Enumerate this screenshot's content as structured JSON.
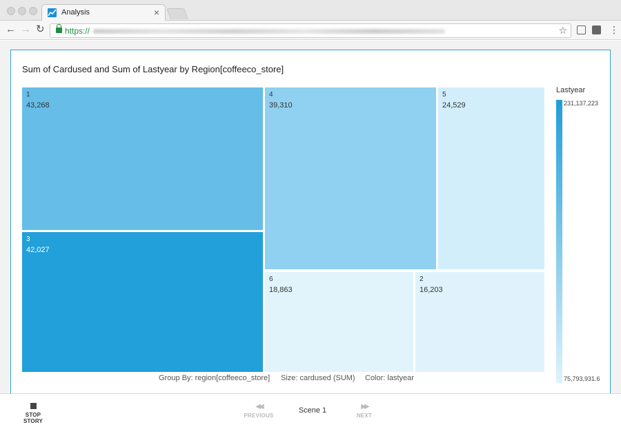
{
  "browser": {
    "tab_title": "Analysis",
    "url_scheme": "https://",
    "colors": {
      "lock": "#1e8e3e",
      "accent": "#2e9fd6"
    }
  },
  "visual": {
    "title": "Sum of Cardused and Sum of Lastyear by Region[coffeeco_store]",
    "group_by": "Group By: region[coffeeco_store]",
    "size": "Size: cardused (SUM)",
    "color": "Color: lastyear",
    "legend": {
      "title": "Lastyear",
      "max_label": "231,137,223",
      "min_label": "75,793,931.6"
    }
  },
  "chart_data": {
    "type": "treemap",
    "title": "Sum of Cardused and Sum of Lastyear by Region[coffeeco_store]",
    "size_measure": "cardused (SUM)",
    "color_measure": "lastyear",
    "group_by": "region[coffeeco_store]",
    "tiles": [
      {
        "name": "1",
        "label": "43,268",
        "value": 43268,
        "color": "#66bde8"
      },
      {
        "name": "3",
        "label": "42,027",
        "value": 42027,
        "color": "#21a0d9"
      },
      {
        "name": "4",
        "label": "39,310",
        "value": 39310,
        "color": "#90d1f1"
      },
      {
        "name": "5",
        "label": "24,529",
        "value": 24529,
        "color": "#d2eefb"
      },
      {
        "name": "6",
        "label": "18,863",
        "value": 18863,
        "color": "#e1f4fc"
      },
      {
        "name": "2",
        "label": "16,203",
        "value": 16203,
        "color": "#e0f3fc"
      }
    ],
    "legend": {
      "title": "Lastyear",
      "max": 231137223,
      "min": 75793931.6,
      "placement": "right"
    }
  },
  "story": {
    "stop_label": "STOP STORY",
    "previous_label": "PREVIOUS",
    "next_label": "NEXT",
    "scene_label": "Scene 1"
  }
}
